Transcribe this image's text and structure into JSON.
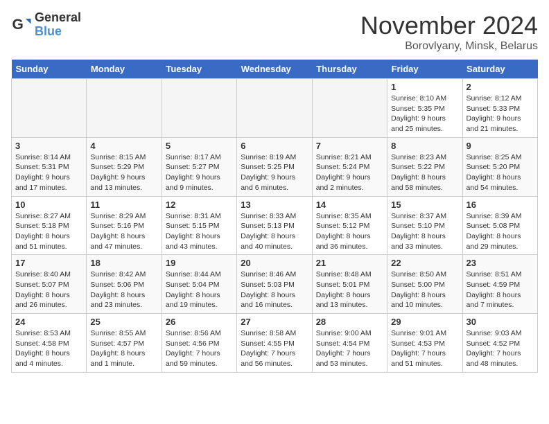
{
  "logo": {
    "general": "General",
    "blue": "Blue"
  },
  "title": "November 2024",
  "location": "Borovlyany, Minsk, Belarus",
  "weekdays": [
    "Sunday",
    "Monday",
    "Tuesday",
    "Wednesday",
    "Thursday",
    "Friday",
    "Saturday"
  ],
  "weeks": [
    [
      {
        "day": "",
        "info": "",
        "empty": true
      },
      {
        "day": "",
        "info": "",
        "empty": true
      },
      {
        "day": "",
        "info": "",
        "empty": true
      },
      {
        "day": "",
        "info": "",
        "empty": true
      },
      {
        "day": "",
        "info": "",
        "empty": true
      },
      {
        "day": "1",
        "info": "Sunrise: 8:10 AM\nSunset: 5:35 PM\nDaylight: 9 hours\nand 25 minutes."
      },
      {
        "day": "2",
        "info": "Sunrise: 8:12 AM\nSunset: 5:33 PM\nDaylight: 9 hours\nand 21 minutes."
      }
    ],
    [
      {
        "day": "3",
        "info": "Sunrise: 8:14 AM\nSunset: 5:31 PM\nDaylight: 9 hours\nand 17 minutes."
      },
      {
        "day": "4",
        "info": "Sunrise: 8:15 AM\nSunset: 5:29 PM\nDaylight: 9 hours\nand 13 minutes."
      },
      {
        "day": "5",
        "info": "Sunrise: 8:17 AM\nSunset: 5:27 PM\nDaylight: 9 hours\nand 9 minutes."
      },
      {
        "day": "6",
        "info": "Sunrise: 8:19 AM\nSunset: 5:25 PM\nDaylight: 9 hours\nand 6 minutes."
      },
      {
        "day": "7",
        "info": "Sunrise: 8:21 AM\nSunset: 5:24 PM\nDaylight: 9 hours\nand 2 minutes."
      },
      {
        "day": "8",
        "info": "Sunrise: 8:23 AM\nSunset: 5:22 PM\nDaylight: 8 hours\nand 58 minutes."
      },
      {
        "day": "9",
        "info": "Sunrise: 8:25 AM\nSunset: 5:20 PM\nDaylight: 8 hours\nand 54 minutes."
      }
    ],
    [
      {
        "day": "10",
        "info": "Sunrise: 8:27 AM\nSunset: 5:18 PM\nDaylight: 8 hours\nand 51 minutes."
      },
      {
        "day": "11",
        "info": "Sunrise: 8:29 AM\nSunset: 5:16 PM\nDaylight: 8 hours\nand 47 minutes."
      },
      {
        "day": "12",
        "info": "Sunrise: 8:31 AM\nSunset: 5:15 PM\nDaylight: 8 hours\nand 43 minutes."
      },
      {
        "day": "13",
        "info": "Sunrise: 8:33 AM\nSunset: 5:13 PM\nDaylight: 8 hours\nand 40 minutes."
      },
      {
        "day": "14",
        "info": "Sunrise: 8:35 AM\nSunset: 5:12 PM\nDaylight: 8 hours\nand 36 minutes."
      },
      {
        "day": "15",
        "info": "Sunrise: 8:37 AM\nSunset: 5:10 PM\nDaylight: 8 hours\nand 33 minutes."
      },
      {
        "day": "16",
        "info": "Sunrise: 8:39 AM\nSunset: 5:08 PM\nDaylight: 8 hours\nand 29 minutes."
      }
    ],
    [
      {
        "day": "17",
        "info": "Sunrise: 8:40 AM\nSunset: 5:07 PM\nDaylight: 8 hours\nand 26 minutes."
      },
      {
        "day": "18",
        "info": "Sunrise: 8:42 AM\nSunset: 5:06 PM\nDaylight: 8 hours\nand 23 minutes."
      },
      {
        "day": "19",
        "info": "Sunrise: 8:44 AM\nSunset: 5:04 PM\nDaylight: 8 hours\nand 19 minutes."
      },
      {
        "day": "20",
        "info": "Sunrise: 8:46 AM\nSunset: 5:03 PM\nDaylight: 8 hours\nand 16 minutes."
      },
      {
        "day": "21",
        "info": "Sunrise: 8:48 AM\nSunset: 5:01 PM\nDaylight: 8 hours\nand 13 minutes."
      },
      {
        "day": "22",
        "info": "Sunrise: 8:50 AM\nSunset: 5:00 PM\nDaylight: 8 hours\nand 10 minutes."
      },
      {
        "day": "23",
        "info": "Sunrise: 8:51 AM\nSunset: 4:59 PM\nDaylight: 8 hours\nand 7 minutes."
      }
    ],
    [
      {
        "day": "24",
        "info": "Sunrise: 8:53 AM\nSunset: 4:58 PM\nDaylight: 8 hours\nand 4 minutes."
      },
      {
        "day": "25",
        "info": "Sunrise: 8:55 AM\nSunset: 4:57 PM\nDaylight: 8 hours\nand 1 minute."
      },
      {
        "day": "26",
        "info": "Sunrise: 8:56 AM\nSunset: 4:56 PM\nDaylight: 7 hours\nand 59 minutes."
      },
      {
        "day": "27",
        "info": "Sunrise: 8:58 AM\nSunset: 4:55 PM\nDaylight: 7 hours\nand 56 minutes."
      },
      {
        "day": "28",
        "info": "Sunrise: 9:00 AM\nSunset: 4:54 PM\nDaylight: 7 hours\nand 53 minutes."
      },
      {
        "day": "29",
        "info": "Sunrise: 9:01 AM\nSunset: 4:53 PM\nDaylight: 7 hours\nand 51 minutes."
      },
      {
        "day": "30",
        "info": "Sunrise: 9:03 AM\nSunset: 4:52 PM\nDaylight: 7 hours\nand 48 minutes."
      }
    ]
  ]
}
